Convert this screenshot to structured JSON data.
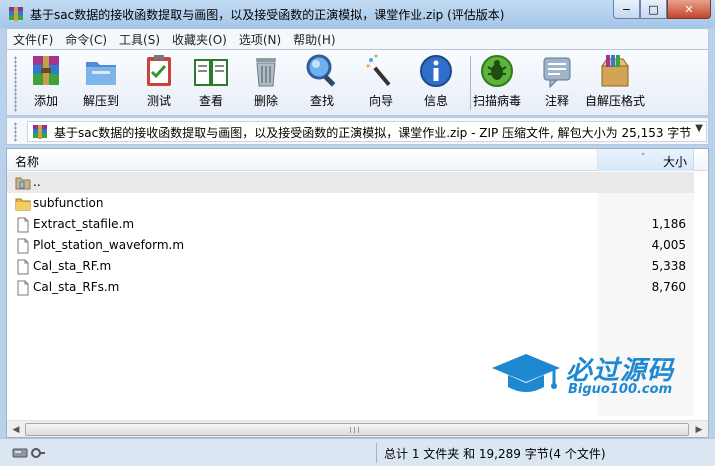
{
  "window": {
    "title": "基于sac数据的接收函数提取与画图，以及接受函数的正演模拟，课堂作业.zip (评估版本)",
    "min_symbol": "−",
    "max_symbol": "□",
    "close_symbol": "✕"
  },
  "menu": [
    "文件(F)",
    "命令(C)",
    "工具(S)",
    "收藏夹(O)",
    "选项(N)",
    "帮助(H)"
  ],
  "toolbar": {
    "add": "添加",
    "extract": "解压到",
    "test": "测试",
    "view": "查看",
    "delete": "删除",
    "find": "查找",
    "wizard": "向导",
    "info": "信息",
    "scan": "扫描病毒",
    "comment": "注释",
    "sfx": "自解压格式"
  },
  "address": {
    "text": "基于sac数据的接收函数提取与画图，以及接受函数的正演模拟，课堂作业.zip - ZIP 压缩文件, 解包大小为 25,153 字节",
    "dropdown": "▼"
  },
  "columns": {
    "name": "名称",
    "size": "大小",
    "sort_indicator": "˄"
  },
  "files": [
    {
      "name": "..",
      "size": "",
      "icon": "up-folder-icon"
    },
    {
      "name": "subfunction",
      "size": "",
      "icon": "folder-icon"
    },
    {
      "name": "Extract_stafile.m",
      "size": "1,186",
      "icon": "file-icon"
    },
    {
      "name": "Plot_station_waveform.m",
      "size": "4,005",
      "icon": "file-icon"
    },
    {
      "name": "Cal_sta_RF.m",
      "size": "5,338",
      "icon": "file-icon"
    },
    {
      "name": "Cal_sta_RFs.m",
      "size": "8,760",
      "icon": "file-icon"
    }
  ],
  "scrollbar": {
    "left": "◀",
    "right": "▶"
  },
  "status": {
    "text": "总计 1 文件夹 和 19,289 字节(4 个文件)"
  },
  "watermark": {
    "cn": "必过源码",
    "en": "Biguo100.com"
  },
  "colors": {
    "accent": "#1e88d0",
    "titlebar": "#b9d1ea"
  }
}
